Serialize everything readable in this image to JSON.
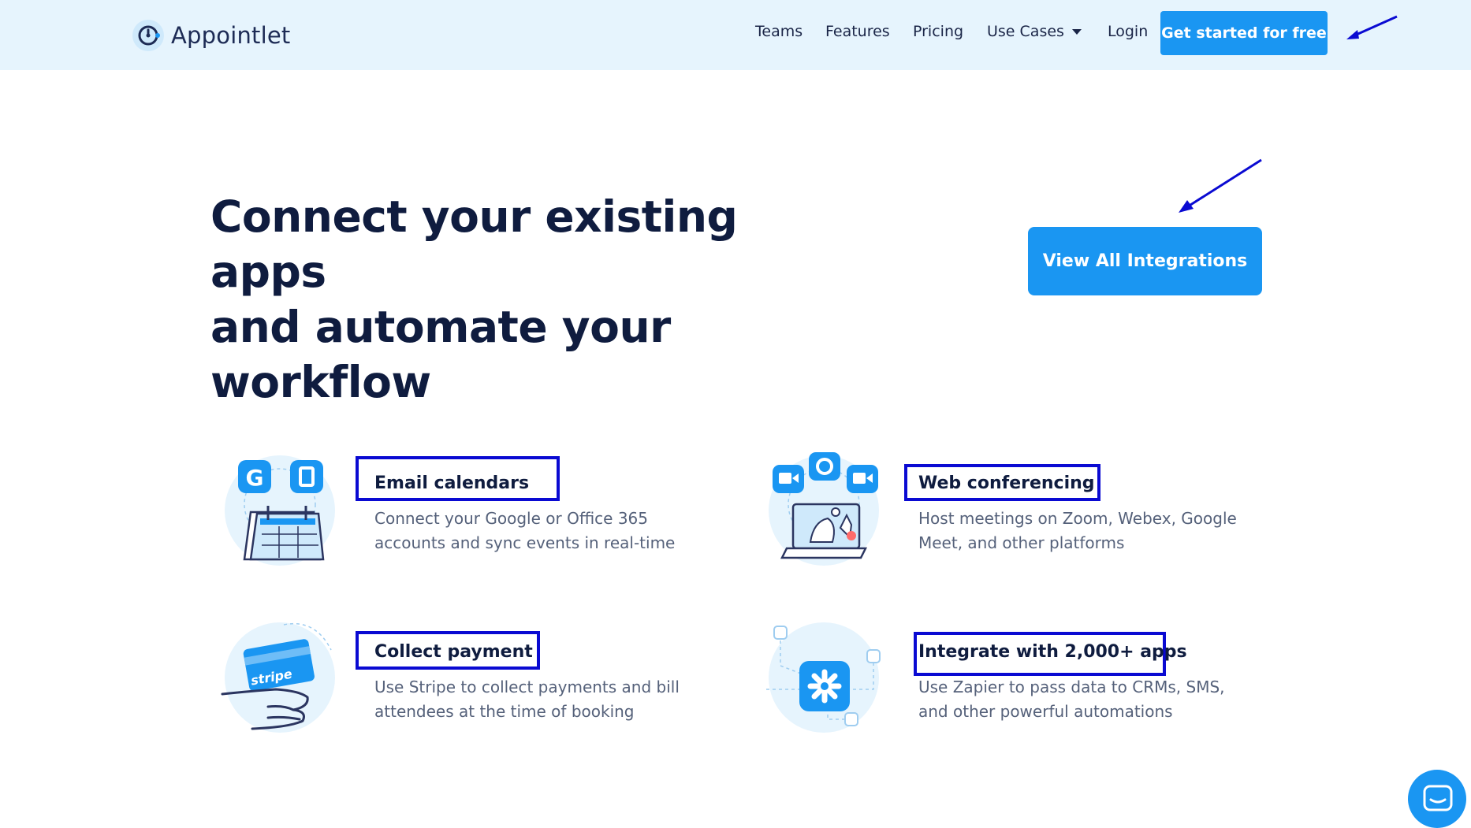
{
  "brand": {
    "name": "Appointlet",
    "accent": "#1a96f2",
    "header_bg": "#e6f4fd",
    "annotation": "#0a0ad2"
  },
  "nav": {
    "teams": "Teams",
    "features": "Features",
    "pricing": "Pricing",
    "use_cases": "Use Cases",
    "login": "Login",
    "cta": "Get started for free"
  },
  "hero": {
    "title_line1": "Connect your existing apps",
    "title_line2": "and automate your workflow",
    "button": "View All Integrations"
  },
  "features": {
    "email": {
      "title": "Email calendars",
      "desc_line1": "Connect your Google or Office 365",
      "desc_line2": "accounts and sync events in real-time",
      "icon": "calendar-sync-icon"
    },
    "conferencing": {
      "title": "Web conferencing",
      "desc_line1": "Host meetings on Zoom, Webex, Google",
      "desc_line2": "Meet, and other platforms",
      "icon": "video-conference-icon"
    },
    "payment": {
      "title": "Collect payment",
      "desc_line1": "Use Stripe to collect payments and bill",
      "desc_line2": "attendees at the time of booking",
      "icon": "stripe-card-icon",
      "card_label": "stripe"
    },
    "zapier": {
      "title": "Integrate with 2,000+ apps",
      "desc_line1": "Use Zapier to pass data to CRMs, SMS,",
      "desc_line2": "and other powerful automations",
      "icon": "zapier-icon"
    }
  },
  "chat": {
    "icon": "chat-launcher-icon"
  }
}
